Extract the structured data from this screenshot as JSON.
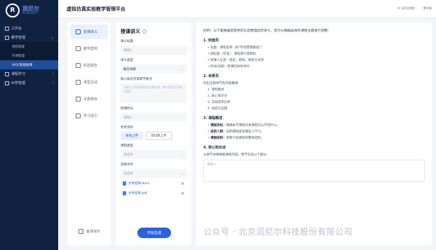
{
  "app": {
    "logo_mark": "R",
    "logo_cn": "润尼尔",
    "logo_en": "RUNSOFT",
    "title": "虚拟仿真实验教学管理平台"
  },
  "header": {
    "right_items": [
      "⚙ 无纸化课程",
      "教学管"
    ]
  },
  "sidebar": {
    "items": [
      {
        "label": "工作台",
        "icon": "dashboard-icon",
        "expandable": false
      },
      {
        "label": "教学管理",
        "icon": "book-icon",
        "expandable": true,
        "expanded": true
      },
      {
        "label": "课程管理",
        "sub": true
      },
      {
        "label": "开课管理",
        "sub": true
      },
      {
        "label": "AIGC智能备课",
        "sub": true,
        "active": true
      },
      {
        "label": "课程学习",
        "icon": "study-icon",
        "expandable": true
      },
      {
        "label": "AI学管理",
        "icon": "ai-icon",
        "expandable": true
      }
    ]
  },
  "tools": {
    "items": [
      {
        "label": "授课讲义",
        "icon": "doc-icon",
        "active": true
      },
      {
        "label": "教学案例",
        "icon": "case-icon"
      },
      {
        "label": "实验报告",
        "icon": "report-icon"
      },
      {
        "label": "课堂互动",
        "icon": "chat-icon"
      },
      {
        "label": "试卷题目",
        "icon": "exam-icon"
      },
      {
        "label": "学习指引",
        "icon": "guide-icon"
      }
    ],
    "bottom": {
      "label": "备课资料",
      "icon": "folder-icon"
    }
  },
  "form": {
    "title": "授课讲义",
    "fields": {
      "topic_label": "讲义标题",
      "topic_placeholder": "请输入",
      "type_label": "讲义类型",
      "type_value": "概念讲解",
      "points_label": "核心知识点或章节要点",
      "points_placeholder": "可输入已完成的知识点等内容，每个知识点可进行换行",
      "duration_label": "授课时长",
      "duration_placeholder": "请输入",
      "upload_label": "参考资料",
      "upload_local": "本地上传",
      "upload_library": "资料库上传",
      "course_label": "课程类型",
      "course_placeholder": "请选择",
      "file_label": "选择文件",
      "file_placeholder": "请选择"
    },
    "files": [
      "文件名称.docx",
      "文件名称.pdf"
    ],
    "generate_label": "开始生成"
  },
  "content": {
    "intro": "好的！以下是根据您提供的信息整理出的讲义，您可以根据具体的课程主题进行调整：",
    "s1_title": "1. 封面页",
    "s1_items": [
      "标题：课程名称（如\"市场营销基础\"）",
      "副标题（可选）：课程简介或目标",
      "授课人信息：姓名、职称、联系方式等",
      "时间/日期：授课的具体时间"
    ],
    "s2_title": "2. 目录页",
    "s2_intro": "列出主要章节及内容概要：",
    "s2_items": [
      "1. 课程概述",
      "2. 核心知识点",
      "3. 实践案例分析",
      "4. 总结与答疑"
    ],
    "s3_title": "3. 课程概述",
    "s3_items": [
      {
        "b": "课程目标：",
        "t": "明确本节课程对本课程可以学到什么。"
      },
      {
        "b": "适用人群：",
        "t": "说明课程适合哪些人学习。"
      },
      {
        "b": "课程结构：",
        "t": "简要介绍课程的整体结构。"
      }
    ],
    "s4_title": "4. 核心知识点",
    "s4_intro": "分章节详细讲解课程内容，每节包括以下部分：",
    "input_placeholder": "请输入"
  },
  "watermark": "公众号 · 北京润尼尔科技股份有限公司",
  "colors": {
    "sidebar_bg": "#0f2341",
    "accent": "#2a63e0",
    "active_sub": "#1f4d9a"
  }
}
